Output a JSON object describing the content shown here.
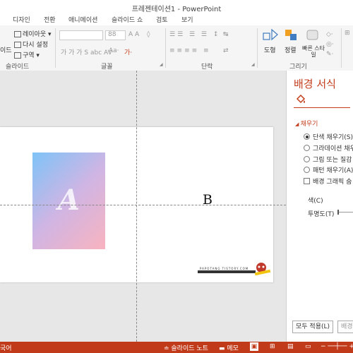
{
  "window": {
    "title": "프레젠테이션1 - PowerPoint"
  },
  "tabs": [
    {
      "label": "디자인"
    },
    {
      "label": "전환"
    },
    {
      "label": "애니메이션"
    },
    {
      "label": "슬라이드 쇼"
    },
    {
      "label": "검토"
    },
    {
      "label": "보기"
    }
  ],
  "ribbon": {
    "slides_group": {
      "label": "슬라이드",
      "partial_label": "이드",
      "layout_label": "레이아웃",
      "reset_label": "다시 설정",
      "section_label": "구역"
    },
    "font_group": {
      "label": "글꼴",
      "font_size": "88"
    },
    "paragraph_group": {
      "label": "단락"
    },
    "drawing_group": {
      "label": "그리기",
      "shapes_label": "도형",
      "arrange_label": "정렬",
      "quick_styles_label": "빠른 스타일"
    }
  },
  "slide": {
    "big_letter": "A",
    "letter_b": "B",
    "watermark_text": "PAPOTANG.TISTORY.COM"
  },
  "format_pane": {
    "title": "배경 서식",
    "section_label": "채우기",
    "options": [
      {
        "label": "단색 채우기(S)",
        "selected": true
      },
      {
        "label": "그라데이션 채우",
        "selected": false
      },
      {
        "label": "그림 또는 질감",
        "selected": false
      },
      {
        "label": "패턴 채우기(A)",
        "selected": false
      }
    ],
    "hide_graphics_label": "배경 그래픽 숨",
    "color_label": "색(C)",
    "transparency_label": "투명도(T)",
    "apply_all_label": "모두 적용(L)",
    "reset_label": "배경"
  },
  "statusbar": {
    "lang": "국어",
    "notes_label": "슬라이드 노트",
    "memo_label": "메모"
  },
  "colors": {
    "accent": "#c43e1c",
    "statusbar": "#c13b1b",
    "gradient_top": "#7ec3f7",
    "gradient_bottom": "#f9b3bf"
  }
}
